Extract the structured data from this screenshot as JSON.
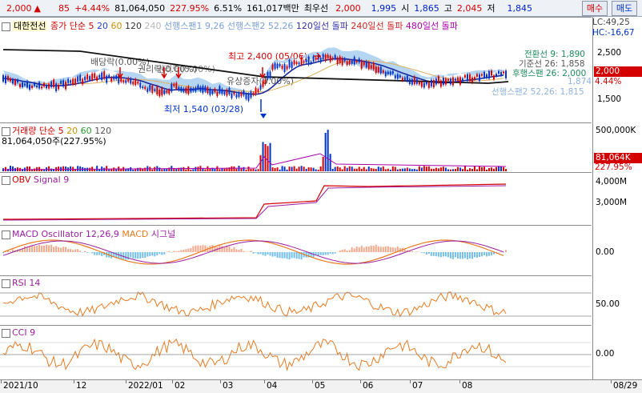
{
  "topbar": {
    "price": "2,000",
    "arrow": "▲",
    "change": "85",
    "change_pct": "+4.44%",
    "volume": "81,064,050",
    "vol_ratio": "227.95%",
    "turnover": "6.51%",
    "amount": "161,017백만",
    "best_ask_label": "최우선",
    "best_ask": "2,000",
    "best_bid": "1,995",
    "open_label": "시",
    "open": "1,865",
    "high_label": "고",
    "high": "2,045",
    "low_label": "저",
    "low": "1,845",
    "buy_label": "매수",
    "sell_label": "매도"
  },
  "price_panel": {
    "header_check": "대한전선",
    "header_items": [
      "종가 단순 5",
      "20",
      "60",
      "120",
      "240",
      "선행스팬1 9,26",
      "선행스팬2 52,26",
      "120일선 돌파",
      "240일선 돌파",
      "480일선 돌파"
    ],
    "header_colors": [
      "#cc0000",
      "#2244cc",
      "#c89000",
      "#333333",
      "#b8b8b8",
      "#7aa0d8",
      "#7aa0d8",
      "#3333aa",
      "#cc2222",
      "#aa00aa"
    ],
    "lc": "LC:49,25",
    "hc": "HC:-16,67",
    "ichimoku": [
      "전환선 9: 1,890",
      "기준선 26: 1,858",
      "후행스팬 26: 2,000",
      "1,874",
      "선행스팬2 52,26: 1,815"
    ],
    "axis_ticks": [
      "2,500",
      "1,500"
    ],
    "price_tag": "2,000",
    "pct_tag": "4.44%",
    "annotations": {
      "high": "최고 2,400 (05/06)",
      "low": "최저 1,540 (03/28)",
      "a1": "배당락(0.00%)",
      "a2": "권리락(0.00%)",
      "a3": "유상증자(0.00%)",
      "a4": "권리락(0.00%)"
    }
  },
  "volume_panel": {
    "title": "거래량 단순 5",
    "ma": [
      "20",
      "60",
      "120"
    ],
    "value": "81,064,050주(227.95%)",
    "axis": "500,000K",
    "tag": "81,064K",
    "tag_pct": "227.95%"
  },
  "obv_panel": {
    "title": "OBV",
    "signal": "Signal 9",
    "axis": [
      "4,000M",
      "3,000M"
    ]
  },
  "macd_panel": {
    "title": "MACD Oscillator 12,26,9",
    "macd": "MACD",
    "signal": "시그널",
    "axis": "0.00"
  },
  "rsi_panel": {
    "title": "RSI 14",
    "axis": "50.00"
  },
  "cci_panel": {
    "title": "CCI 9",
    "axis": "0.00"
  },
  "dates": [
    "2021/10",
    "12",
    "2022/01",
    "02",
    "03",
    "04",
    "05",
    "06",
    "07",
    "08",
    "08/29"
  ],
  "colors": {
    "up": "#d40000",
    "down": "#0033cc",
    "orange": "#e87a20",
    "purple": "#9a1fa0"
  }
}
